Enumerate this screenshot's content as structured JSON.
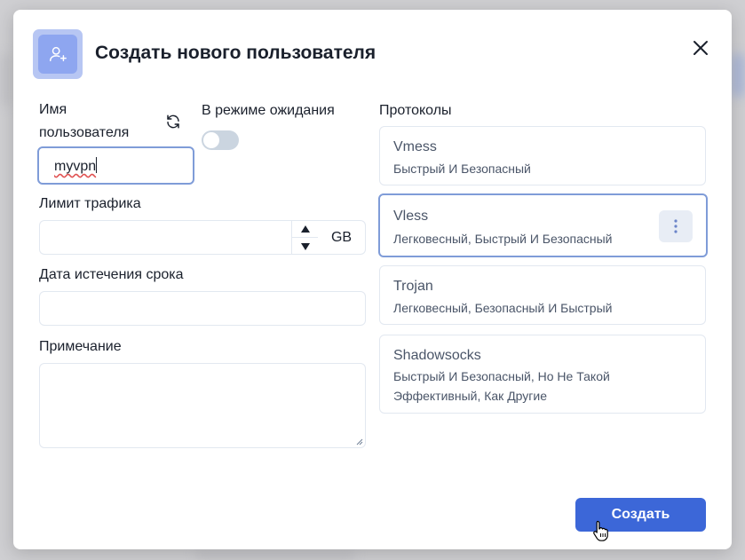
{
  "header": {
    "title": "Создать нового пользователя",
    "icon": "user-plus-icon",
    "close_icon": "close-icon"
  },
  "form": {
    "username": {
      "label": "Имя пользователя",
      "value": "myvpn",
      "regenerate_icon": "refresh-icon"
    },
    "on_hold": {
      "label": "В режиме ожидания",
      "enabled": false
    },
    "traffic_limit": {
      "label": "Лимит трафика",
      "value": "",
      "unit": "GB"
    },
    "expiry_date": {
      "label": "Дата истечения срока",
      "value": ""
    },
    "note": {
      "label": "Примечание",
      "value": ""
    }
  },
  "protocols": {
    "label": "Протоколы",
    "items": [
      {
        "name": "Vmess",
        "description": "Быстрый И Безопасный",
        "selected": false
      },
      {
        "name": "Vless",
        "description": "Легковесный, Быстрый И Безопасный",
        "selected": true
      },
      {
        "name": "Trojan",
        "description": "Легковесный, Безопасный И Быстрый",
        "selected": false
      },
      {
        "name": "Shadowsocks",
        "description": "Быстрый И Безопасный, Но Не Такой Эффективный, Как Другие",
        "selected": false
      }
    ]
  },
  "footer": {
    "create_label": "Создать"
  },
  "colors": {
    "accent": "#3c67d8",
    "focus_border": "#7f9cd8",
    "header_icon_bg": "#8ea6f0"
  }
}
